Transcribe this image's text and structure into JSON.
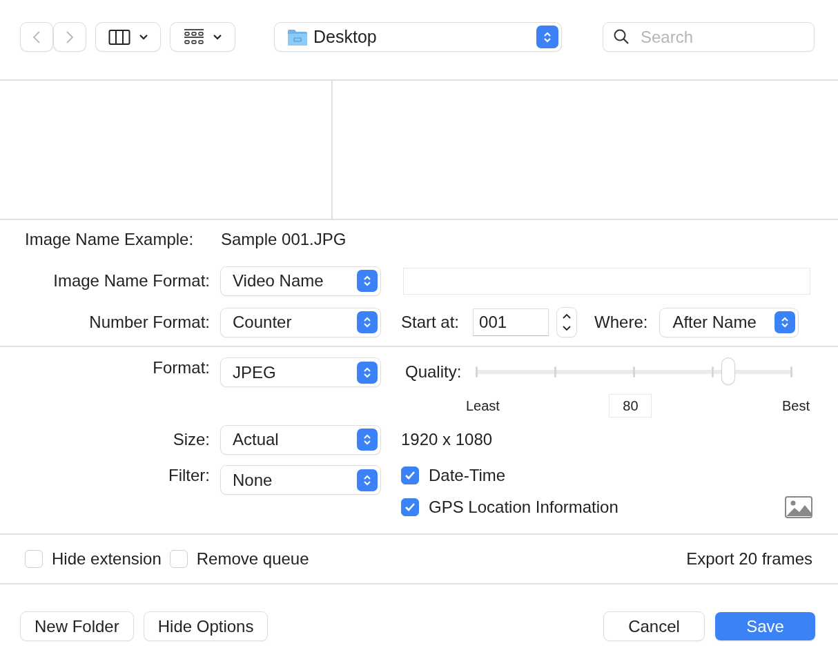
{
  "toolbar": {
    "location": "Desktop",
    "search": {
      "placeholder": "Search"
    }
  },
  "naming": {
    "example_label": "Image Name Example:",
    "example_value": "Sample 001.JPG",
    "name_format": {
      "label": "Image Name Format:",
      "value": "Video Name"
    },
    "number_format": {
      "label": "Number Format:",
      "value": "Counter"
    },
    "start_at": {
      "label": "Start at:",
      "value": "001"
    },
    "where": {
      "label": "Where:",
      "value": "After Name"
    }
  },
  "output": {
    "format": {
      "label": "Format:",
      "value": "JPEG"
    },
    "quality": {
      "label": "Quality:",
      "level": 0.8,
      "min_label": "Least",
      "value": "80",
      "max_label": "Best"
    },
    "size": {
      "label": "Size:",
      "value": "Actual",
      "dimensions": "1920 x 1080"
    },
    "filter": {
      "label": "Filter:",
      "value": "None"
    },
    "metadata": [
      {
        "label": "Date-Time",
        "checked": true
      },
      {
        "label": "GPS Location Information",
        "checked": true
      }
    ]
  },
  "options": [
    {
      "label": "Hide extension",
      "checked": false
    },
    {
      "label": "Remove queue",
      "checked": false
    }
  ],
  "export_count": "Export 20 frames",
  "buttons_left": [
    "New Folder",
    "Hide Options"
  ],
  "buttons_right": [
    {
      "label": "Cancel",
      "kind": "normal"
    },
    {
      "label": "Save",
      "kind": "default"
    }
  ]
}
